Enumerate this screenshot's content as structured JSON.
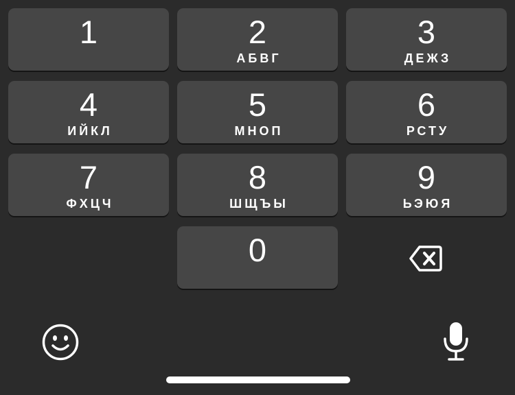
{
  "keypad": {
    "keys": [
      {
        "digit": "1",
        "letters": ""
      },
      {
        "digit": "2",
        "letters": "АБВГ"
      },
      {
        "digit": "3",
        "letters": "ДЕЖЗ"
      },
      {
        "digit": "4",
        "letters": "ИЙКЛ"
      },
      {
        "digit": "5",
        "letters": "МНОП"
      },
      {
        "digit": "6",
        "letters": "РСТУ"
      },
      {
        "digit": "7",
        "letters": "ФХЦЧ"
      },
      {
        "digit": "8",
        "letters": "ШЩЪЫ"
      },
      {
        "digit": "9",
        "letters": "ЬЭЮЯ"
      },
      {
        "digit": "0",
        "letters": ""
      }
    ]
  },
  "icons": {
    "backspace": "backspace-icon",
    "emoji": "emoji-icon",
    "microphone": "microphone-icon"
  },
  "colors": {
    "background": "#2b2b2b",
    "key_background": "#464646",
    "text": "#ffffff"
  }
}
